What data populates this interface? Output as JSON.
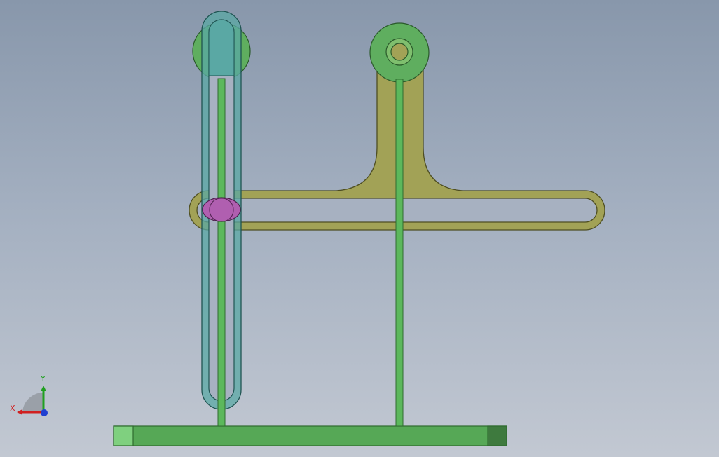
{
  "viewport": {
    "background_top": "#8897ab",
    "background_bottom": "#c2c8d2"
  },
  "colors": {
    "base_plate": "#56a856",
    "base_plate_end": "#7fd07f",
    "base_plate_end_dark": "#3a6e3a",
    "rods": "#5cb85c",
    "rod_outline": "#2f6b2f",
    "slotted_link": "#5aa8a4",
    "slotted_link_outline": "#1f5452",
    "slider_arm": "#a2a256",
    "slider_arm_outline": "#4e4e22",
    "pin": "#b05fb0",
    "pin_outline": "#4b1f4b",
    "pivot_disc": "#5fae5f",
    "pivot_outline": "#2a5a2a"
  },
  "triad": {
    "x_label": "X",
    "y_label": "Y",
    "x_color": "#d02020",
    "y_color": "#20a020",
    "z_color": "#2040d0",
    "x_icon": "x-axis-arrow-icon",
    "y_icon": "y-axis-arrow-icon",
    "z_icon": "z-axis-dot-icon"
  }
}
